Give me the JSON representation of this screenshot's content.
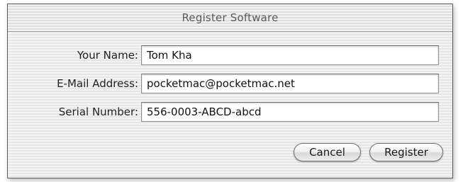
{
  "window": {
    "title": "Register Software"
  },
  "form": {
    "name_label": "Your Name:",
    "name_value": "Tom Kha",
    "email_label": "E-Mail Address:",
    "email_value": "pocketmac@pocketmac.net",
    "serial_label": "Serial Number:",
    "serial_value": "556-0003-ABCD-abcd"
  },
  "buttons": {
    "cancel_label": "Cancel",
    "register_label": "Register"
  }
}
